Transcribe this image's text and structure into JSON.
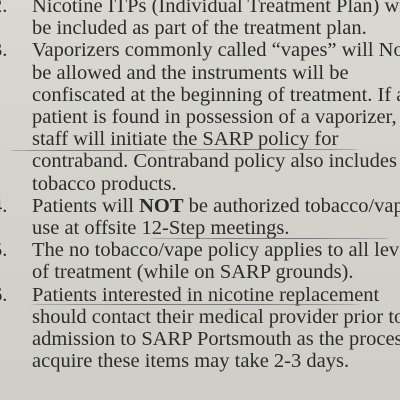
{
  "policy_items": [
    {
      "number": "2.",
      "lines": [
        "Nicotine ITPs (Individual Treatment Plan) will",
        "be included as part of the treatment plan."
      ]
    },
    {
      "number": "3.",
      "lines": [
        "Vaporizers commonly called “vapes” will Not",
        "be allowed and the instruments will be",
        "confiscated at the beginning of treatment.  If a",
        "patient is found in possession of a vaporizer,",
        "staff will initiate the SARP policy for",
        "contraband. Contraband policy also includes",
        "tobacco products."
      ]
    },
    {
      "number": "4.",
      "line1_before": "Patients will ",
      "line1_strong": "NOT",
      "line1_after": " be authorized tobacco/vape",
      "line2": "use at offsite 12-Step meetings."
    },
    {
      "number": "5.",
      "lines": [
        "The no tobacco/vape policy applies to all levels",
        "of treatment (while on SARP grounds)."
      ]
    },
    {
      "number": "6.",
      "lines": [
        "Patients interested in nicotine replacement",
        "should contact their medical provider prior to",
        "admission to SARP Portsmouth as the process to",
        "acquire these items may take 2-3 days."
      ]
    }
  ]
}
